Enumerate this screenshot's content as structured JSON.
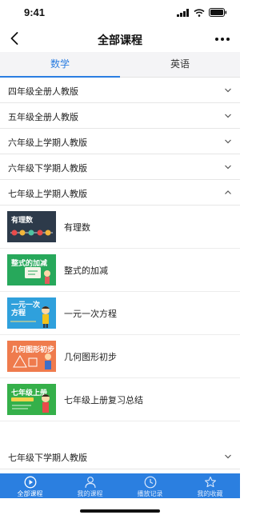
{
  "status": {
    "time": "9:41"
  },
  "nav": {
    "title": "全部课程"
  },
  "tabs": [
    {
      "label": "数学",
      "active": true
    },
    {
      "label": "英语",
      "active": false
    }
  ],
  "grades": [
    {
      "label": "四年级全册人教版",
      "expanded": false
    },
    {
      "label": "五年级全册人教版",
      "expanded": false
    },
    {
      "label": "六年级上学期人教版",
      "expanded": false
    },
    {
      "label": "六年级下学期人教版",
      "expanded": false
    },
    {
      "label": "七年级上学期人教版",
      "expanded": true
    },
    {
      "label": "七年级下学期人教版",
      "expanded": false
    }
  ],
  "lessons": [
    {
      "label": "有理数",
      "thumb_title": "有理数",
      "thumb_bg": "#2d3a4a"
    },
    {
      "label": "整式的加减",
      "thumb_title": "整式的加减",
      "thumb_bg": "#27a85b"
    },
    {
      "label": "一元一次方程",
      "thumb_title": "一元一次\n方程",
      "thumb_bg": "#2fa0dc"
    },
    {
      "label": "几何图形初步",
      "thumb_title": "几何图形初步",
      "thumb_bg": "#ef7b4d"
    },
    {
      "label": "七年级上册复习总结",
      "thumb_title": "七年级上册",
      "thumb_bg": "#35b04a"
    }
  ],
  "bottom_nav": [
    {
      "label": "全部课程",
      "icon": "play-circle-icon",
      "active": true
    },
    {
      "label": "我的课程",
      "icon": "user-icon",
      "active": false
    },
    {
      "label": "播放记录",
      "icon": "clock-icon",
      "active": false
    },
    {
      "label": "我的收藏",
      "icon": "star-icon",
      "active": false
    }
  ],
  "colors": {
    "accent": "#2a7de1",
    "bottom_bar": "#2b7fe0"
  }
}
